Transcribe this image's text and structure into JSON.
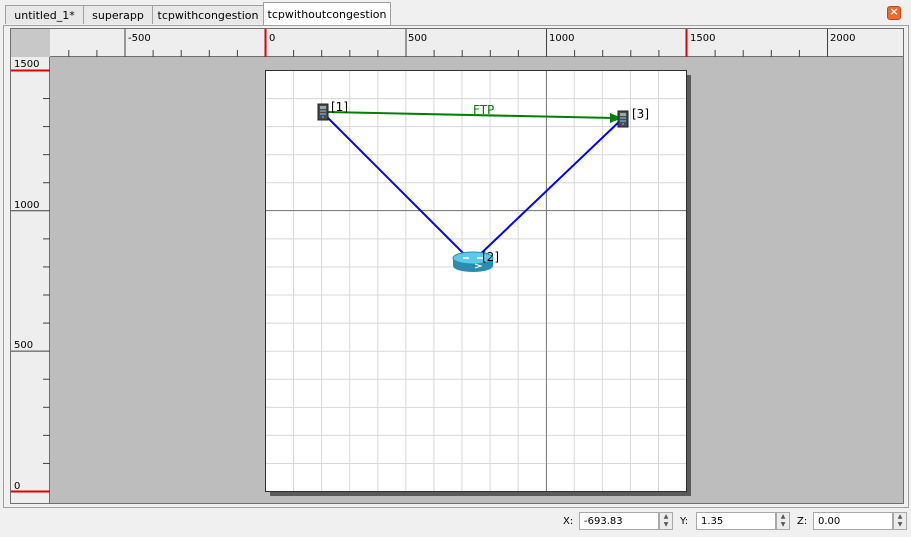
{
  "tabs": [
    {
      "label": "untitled_1*",
      "active": false
    },
    {
      "label": "superapp",
      "active": false
    },
    {
      "label": "tcpwithcongestion",
      "active": false
    },
    {
      "label": "tcpwithoutcongestion",
      "active": true
    }
  ],
  "close_icon": "close-icon",
  "ruler": {
    "horizontal_labels": [
      "-500",
      "0",
      "500",
      "1000",
      "1500",
      "2000"
    ],
    "vertical_labels": [
      "1500",
      "1000",
      "500",
      "0"
    ]
  },
  "scene": {
    "nodes": [
      {
        "id": "[1]",
        "type": "computer-node-icon"
      },
      {
        "id": "[2]",
        "type": "router-node-icon"
      },
      {
        "id": "[3]",
        "type": "computer-node-icon"
      }
    ],
    "app_link_label": "FTP",
    "colors": {
      "link": "#0000ff",
      "app_link": "#008000",
      "grid": "#d8d8d8",
      "axis": "#808080",
      "marker": "#e00000"
    }
  },
  "coords": {
    "x_label": "X:",
    "x_value": "-693.83",
    "y_label": "Y:",
    "y_value": "1.35",
    "z_label": "Z:",
    "z_value": "0.00"
  }
}
